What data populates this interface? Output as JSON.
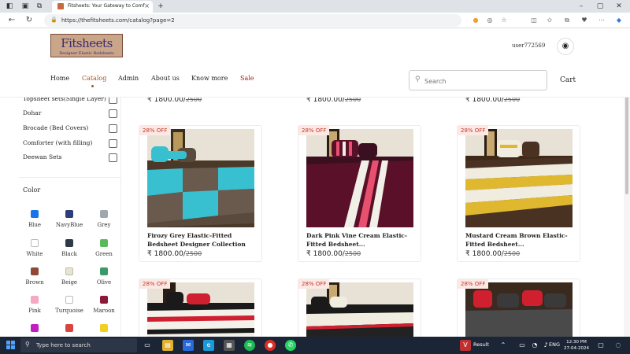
{
  "browser": {
    "tab_title": "Fitsheets: Your Gateway to Comf",
    "tab_close": "×",
    "url": "https://thefitsheets.com/catalog?page=2"
  },
  "site": {
    "logo_line1": "Fitsheets",
    "logo_line2": "Designer Elastic Bedsheets",
    "username": "user772569",
    "nav": [
      "Home",
      "Catalog",
      "Admin",
      "About us",
      "Know more",
      "Sale"
    ],
    "search_placeholder": "Search",
    "cart": "Cart"
  },
  "filters": {
    "types": [
      "Topsheet sets(Single Layer)",
      "Dohar",
      "Brocade (Bed Covers)",
      "Comforter (with filling)",
      "Deewan Sets"
    ],
    "color_title": "Color",
    "colors": [
      {
        "name": "Blue",
        "hex": "#1a73e8"
      },
      {
        "name": "NavyBlue",
        "hex": "#2c3e7a"
      },
      {
        "name": "Grey",
        "hex": "#a0a7ad"
      },
      {
        "name": "White",
        "hex": "#ffffff"
      },
      {
        "name": "Black",
        "hex": "#2e3a48"
      },
      {
        "name": "Green",
        "hex": "#5cb85c"
      },
      {
        "name": "Brown",
        "hex": "#8e4a35"
      },
      {
        "name": "Beige",
        "hex": "#e8e6c9"
      },
      {
        "name": "Olive",
        "hex": "#3a9a6a"
      },
      {
        "name": "Pink",
        "hex": "#f4a9c0"
      },
      {
        "name": "Turquoise",
        "hex": "#ffffff"
      },
      {
        "name": "Maroon",
        "hex": "#8b1a3a"
      },
      {
        "name": "",
        "hex": "#c020c0"
      },
      {
        "name": "",
        "hex": "#d9453f"
      },
      {
        "name": "",
        "hex": "#f0d020"
      }
    ]
  },
  "top_row_prices": [
    {
      "price": "₹ 1800.00/",
      "mrp": "2500"
    },
    {
      "price": "₹ 1800.00/",
      "mrp": "2500"
    },
    {
      "price": "₹ 1800.00/",
      "mrp": "2500"
    }
  ],
  "products": [
    {
      "discount": "28% OFF",
      "title": "Firozy Grey Elastic-Fitted Bedsheet Designer Collection",
      "price": "₹ 1800.00/",
      "mrp": "2500"
    },
    {
      "discount": "28% OFF",
      "title": "Dark Pink Vine Cream Elastic-Fitted Bedsheet...",
      "price": "₹ 1800.00/",
      "mrp": "2500"
    },
    {
      "discount": "28% OFF",
      "title": "Mustard Cream Brown Elastic-Fitted Bedsheet...",
      "price": "₹ 1800.00/",
      "mrp": "2500"
    },
    {
      "discount": "28% OFF"
    },
    {
      "discount": "28% OFF"
    },
    {
      "discount": "28% OFF"
    }
  ],
  "taskbar": {
    "search_placeholder": "Type here to search",
    "result_label": "Result",
    "lang": "ENG",
    "time": "12:30 PM",
    "date": "27-04-2024"
  }
}
